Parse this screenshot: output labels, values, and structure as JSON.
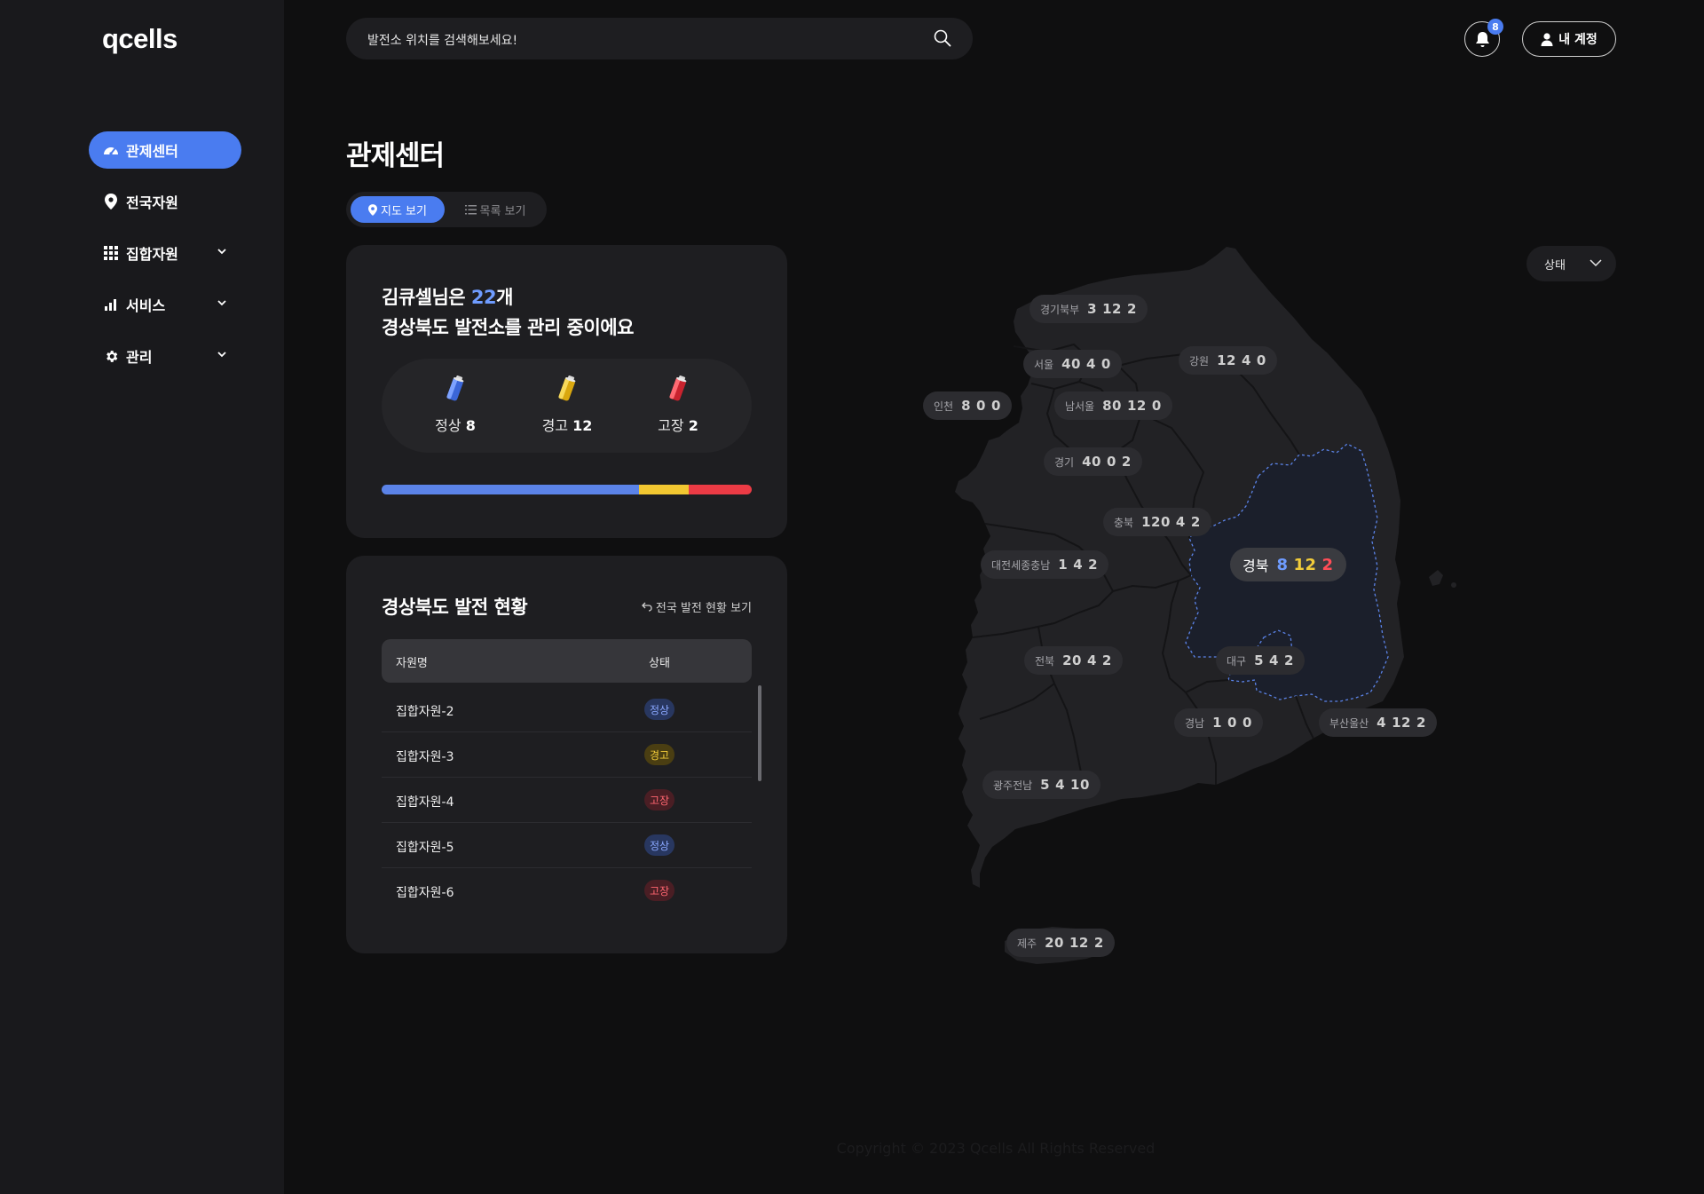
{
  "brand": {
    "logo": "qcells",
    "accent": "#4a7cf0",
    "normal": "#5b83e8",
    "warning": "#f2c731",
    "fault": "#ec3b45"
  },
  "sidebar": {
    "items": [
      {
        "label": "관제센터",
        "icon": "dashboard-icon",
        "active": true
      },
      {
        "label": "전국자원",
        "icon": "location-pin-icon"
      },
      {
        "label": "집합자원",
        "icon": "grid-icon",
        "expandable": true
      },
      {
        "label": "서비스",
        "icon": "bar-chart-icon",
        "expandable": true
      },
      {
        "label": "관리",
        "icon": "gear-icon",
        "expandable": true
      }
    ]
  },
  "header": {
    "search_placeholder": "발전소 위치를 검색해보세요!",
    "notifications_count": "8",
    "account_label": "내 계정"
  },
  "page": {
    "title": "관제센터",
    "view_toggle": {
      "map": "지도 보기",
      "list": "목록 보기",
      "selected": "map"
    }
  },
  "summary": {
    "greeting_prefix": "김큐셀님은 ",
    "count": "22",
    "count_suffix": "개",
    "line2": "경상북도 발전소를 관리 중이에요",
    "stats": [
      {
        "label": "정상",
        "value": "8",
        "color": "#5b83e8",
        "icon": "battery-normal-icon"
      },
      {
        "label": "경고",
        "value": "12",
        "color": "#f2c731",
        "icon": "battery-warning-icon"
      },
      {
        "label": "고장",
        "value": "2",
        "color": "#ec3b45",
        "icon": "battery-fault-icon"
      }
    ],
    "bar_fractions": [
      0.695,
      0.135,
      0.17
    ]
  },
  "regional": {
    "title": "경상북도 발전 현황",
    "link": "전국 발전 현황 보기",
    "columns": [
      "자원명",
      "상태"
    ],
    "rows": [
      {
        "name": "집합자원-2",
        "status": "정상",
        "type": "normal"
      },
      {
        "name": "집합자원-3",
        "status": "경고",
        "type": "warn"
      },
      {
        "name": "집합자원-4",
        "status": "고장",
        "type": "fault"
      },
      {
        "name": "집합자원-5",
        "status": "정상",
        "type": "normal"
      },
      {
        "name": "집합자원-6",
        "status": "고장",
        "type": "fault"
      }
    ]
  },
  "map": {
    "filter_label": "상태",
    "regions": [
      {
        "name": "경기북부",
        "values": [
          "3",
          "12",
          "2"
        ]
      },
      {
        "name": "서울",
        "values": [
          "40",
          "4",
          "0"
        ]
      },
      {
        "name": "강원",
        "values": [
          "12",
          "4",
          "0"
        ]
      },
      {
        "name": "인천",
        "values": [
          "8",
          "0",
          "0"
        ]
      },
      {
        "name": "남서울",
        "values": [
          "80",
          "12",
          "0"
        ]
      },
      {
        "name": "경기",
        "values": [
          "40",
          "0",
          "2"
        ]
      },
      {
        "name": "충북",
        "values": [
          "120",
          "4",
          "2"
        ]
      },
      {
        "name": "대전세종충남",
        "values": [
          "1",
          "4",
          "2"
        ]
      },
      {
        "name": "경북",
        "values": [
          "8",
          "12",
          "2"
        ],
        "selected": true
      },
      {
        "name": "전북",
        "values": [
          "20",
          "4",
          "2"
        ]
      },
      {
        "name": "대구",
        "values": [
          "5",
          "4",
          "2"
        ]
      },
      {
        "name": "경남",
        "values": [
          "1",
          "0",
          "0"
        ]
      },
      {
        "name": "부산울산",
        "values": [
          "4",
          "12",
          "2"
        ]
      },
      {
        "name": "광주전남",
        "values": [
          "5",
          "4",
          "10"
        ]
      },
      {
        "name": "제주",
        "values": [
          "20",
          "12",
          "2"
        ]
      }
    ]
  },
  "footer": "Copyright © 2023 Qcells All Rights Reserved"
}
